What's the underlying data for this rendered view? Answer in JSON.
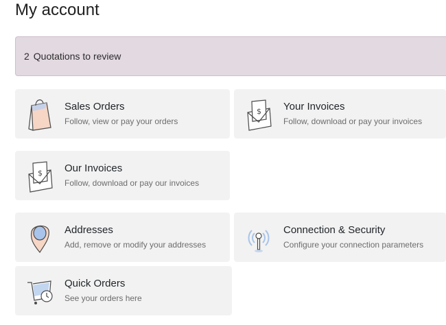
{
  "page": {
    "title": "My account"
  },
  "alert": {
    "count": "2",
    "label": "Quotations to review"
  },
  "cards": {
    "sales_orders": {
      "title": "Sales Orders",
      "desc": "Follow, view or pay your orders",
      "icon": "shopping-bag-icon"
    },
    "your_invoices": {
      "title": "Your Invoices",
      "desc": "Follow, download or pay your invoices",
      "icon": "invoice-envelope-icon"
    },
    "our_invoices": {
      "title": "Our Invoices",
      "desc": "Follow, download or pay our invoices",
      "icon": "invoice-envelope-icon"
    },
    "addresses": {
      "title": "Addresses",
      "desc": "Add, remove or modify your addresses",
      "icon": "map-pin-icon"
    },
    "security": {
      "title": "Connection & Security",
      "desc": "Configure your connection parameters",
      "icon": "antenna-icon"
    },
    "quick_orders": {
      "title": "Quick Orders",
      "desc": "See your orders here",
      "icon": "cart-clock-icon"
    }
  },
  "colors": {
    "alert_bg": "#e3d9e1",
    "card_bg": "#f2f2f2",
    "icon_blue": "#a8c4ea",
    "icon_peach": "#f3c9b5"
  }
}
